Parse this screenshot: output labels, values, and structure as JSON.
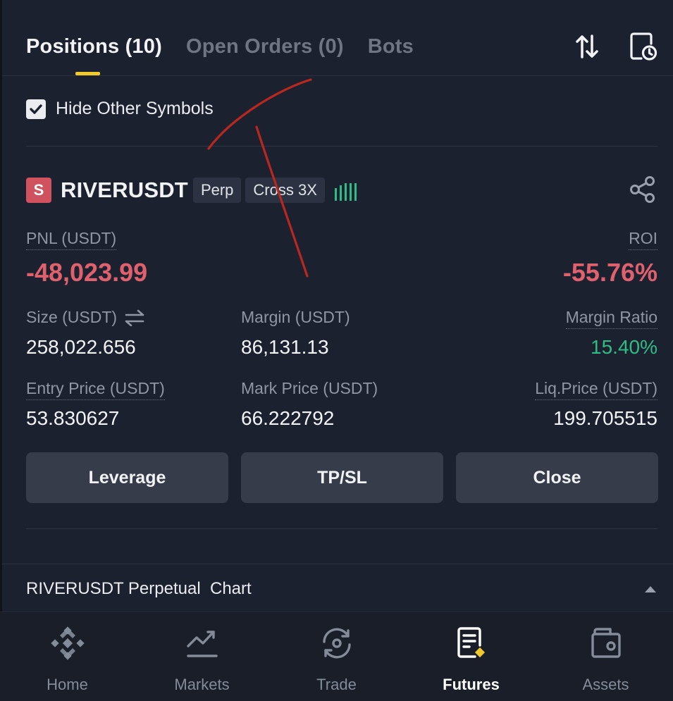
{
  "tabs": [
    {
      "label": "Positions (10)",
      "active": true
    },
    {
      "label": "Open Orders (0)",
      "active": false
    },
    {
      "label": "Bots",
      "active": false
    }
  ],
  "header_icons": [
    "sort-arrows-icon",
    "history-clock-icon"
  ],
  "filter": {
    "label": "Hide Other Symbols",
    "checked": true
  },
  "position": {
    "badge": "S",
    "symbol": "RIVERUSDT",
    "tags": [
      "Perp",
      "Cross 3X"
    ],
    "pnl_label": "PNL (USDT)",
    "pnl_value": "-48,023.99",
    "roi_label": "ROI",
    "roi_value": "-55.76%",
    "size_label": "Size (USDT)",
    "size_value": "258,022.656",
    "margin_label": "Margin (USDT)",
    "margin_value": "86,131.13",
    "margin_ratio_label": "Margin Ratio",
    "margin_ratio_value": "15.40%",
    "entry_label": "Entry Price (USDT)",
    "entry_value": "53.830627",
    "mark_label": "Mark Price (USDT)",
    "mark_value": "66.222792",
    "liq_label": "Liq.Price (USDT)",
    "liq_value": "199.705515"
  },
  "actions": {
    "leverage": "Leverage",
    "tpsl": "TP/SL",
    "close": "Close"
  },
  "chart_section": {
    "title": "RIVERUSDT Perpetual  Chart"
  },
  "nav": [
    {
      "label": "Home",
      "icon": "binance-logo-icon",
      "active": false
    },
    {
      "label": "Markets",
      "icon": "markets-chart-icon",
      "active": false
    },
    {
      "label": "Trade",
      "icon": "trade-swap-icon",
      "active": false
    },
    {
      "label": "Futures",
      "icon": "futures-doc-icon",
      "active": true
    },
    {
      "label": "Assets",
      "icon": "wallet-icon",
      "active": false
    }
  ],
  "colors": {
    "background": "#1c2130",
    "accent": "#f0c92d",
    "negative": "#e0616e",
    "positive": "#2ebd85",
    "annotation": "#b8281e"
  }
}
